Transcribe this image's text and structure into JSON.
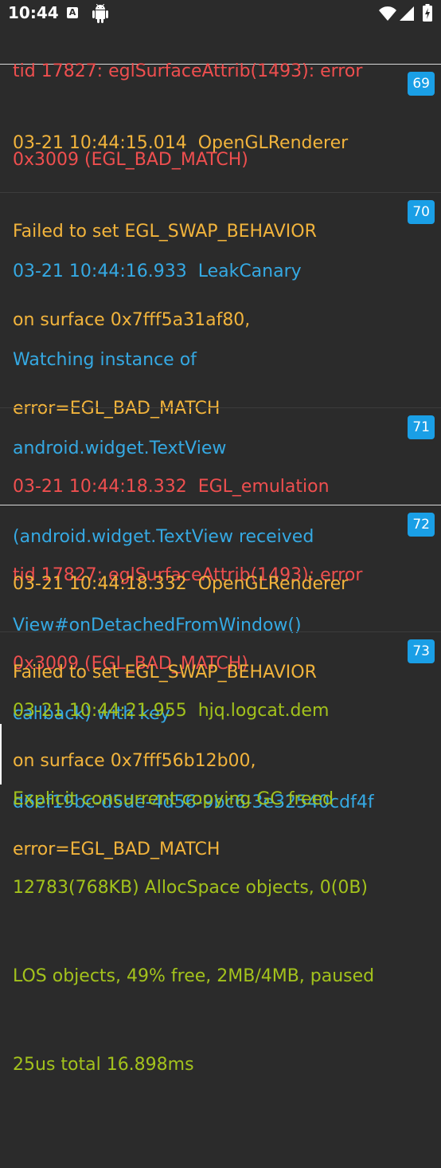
{
  "status_bar": {
    "time": "10:44",
    "notification_letter": "A"
  },
  "log": {
    "partial_top": {
      "lines": [
        "tid 17827: eglSurfaceAttrib(1493): error",
        "0x3009 (EGL_BAD_MATCH)"
      ]
    },
    "entries": [
      {
        "level": "warn",
        "number": "69",
        "lines": [
          "03-21 10:44:15.014  OpenGLRenderer",
          "Failed to set EGL_SWAP_BEHAVIOR",
          "on surface 0x7fff5a31af80,",
          "error=EGL_BAD_MATCH"
        ]
      },
      {
        "level": "debug",
        "number": "70",
        "lines": [
          "03-21 10:44:16.933  LeakCanary",
          "Watching instance of",
          "android.widget.TextView",
          "(android.widget.TextView received",
          "View#onDetachedFromWindow()",
          "callback) with key",
          "d6ef19bc-d5de-4d56-9bc6-3e32540cdf4f"
        ]
      },
      {
        "level": "error",
        "number": "71",
        "lines": [
          "03-21 10:44:18.332  EGL_emulation",
          "tid 17827: eglSurfaceAttrib(1493): error",
          "0x3009 (EGL_BAD_MATCH)"
        ]
      },
      {
        "level": "warn",
        "number": "72",
        "lines": [
          "03-21 10:44:18.332  OpenGLRenderer",
          "Failed to set EGL_SWAP_BEHAVIOR",
          "on surface 0x7fff56b12b00,",
          "error=EGL_BAD_MATCH"
        ]
      },
      {
        "level": "info",
        "number": "73",
        "lines": [
          "03-21 10:44:21.955  hjq.logcat.dem",
          "Explicit concurrent copying GC freed",
          "12783(768KB) AllocSpace objects, 0(0B)",
          "LOS objects, 49% free, 2MB/4MB, paused",
          "25us total 16.898ms"
        ]
      }
    ]
  },
  "colors": {
    "background": "#2b2b2b",
    "error": "#ef4f4f",
    "warn": "#f2b43c",
    "debug": "#35a9e3",
    "info": "#a3c21c",
    "badge": "#1a9fe6"
  }
}
